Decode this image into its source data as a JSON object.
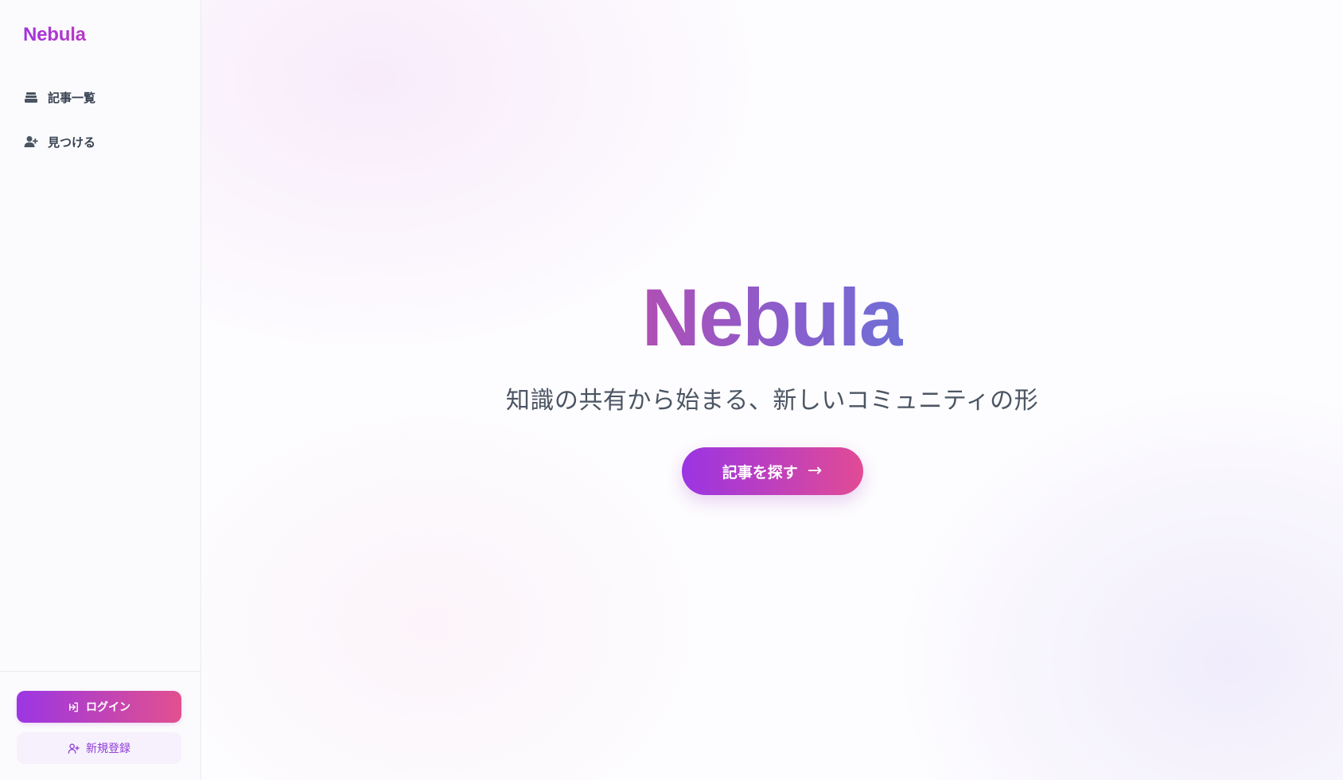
{
  "sidebar": {
    "brand": "Nebula",
    "nav": [
      {
        "label": "記事一覧",
        "icon": "stacked-layers-icon"
      },
      {
        "label": "見つける",
        "icon": "user-plus-icon"
      }
    ],
    "login_label": "ログイン",
    "login_icon": "sign-in-icon",
    "register_label": "新規登録",
    "register_icon": "user-plus-icon"
  },
  "hero": {
    "title": "Nebula",
    "subtitle": "知識の共有から始まる、新しいコミュニティの形",
    "cta_label": "記事を探す",
    "cta_arrow": "→"
  },
  "colors": {
    "brand_gradient_start": "#9b30e6",
    "brand_gradient_end": "#e0489a",
    "text": "#374151"
  }
}
